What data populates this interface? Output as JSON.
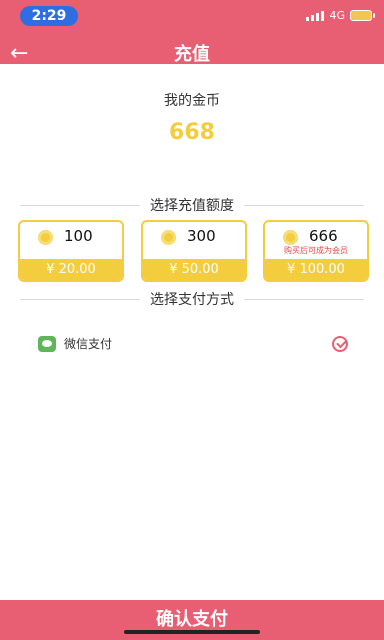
{
  "status": {
    "time": "2:29",
    "network": "4G"
  },
  "header": {
    "title": "充值"
  },
  "balance": {
    "label": "我的金币",
    "value": "668"
  },
  "recharge_section": {
    "title": "选择充值额度"
  },
  "packages": [
    {
      "amount": "100",
      "price": "¥ 20.00",
      "note": ""
    },
    {
      "amount": "300",
      "price": "¥ 50.00",
      "note": ""
    },
    {
      "amount": "666",
      "price": "¥ 100.00",
      "note": "购买后可成为会员"
    }
  ],
  "payment_section": {
    "title": "选择支付方式"
  },
  "payment_method": {
    "label": "微信支付",
    "selected": true
  },
  "footer": {
    "confirm_label": "确认支付"
  },
  "colors": {
    "brand": "#e85f73",
    "accent": "#f4cd3f"
  },
  "icons": {
    "back": "back-arrow-icon",
    "coin": "coin-icon",
    "wechat": "wechat-icon",
    "selected": "check-icon"
  }
}
